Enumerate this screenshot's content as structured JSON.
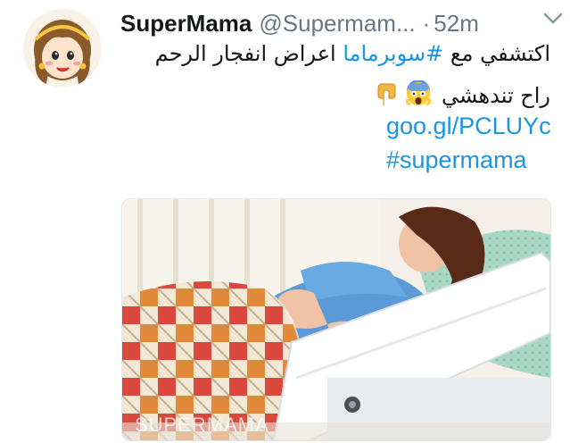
{
  "tweet": {
    "display_name": "SuperMama",
    "handle": "@Supermam...",
    "separator": "·",
    "time": "52m",
    "text_line1_prefix": "اكتشفي مع",
    "hashtag_inline": "#سوبرماما",
    "text_line1_suffix": "اعراض انفجار الرحم",
    "text_line2": "راح تندهشي",
    "link": "goo.gl/PCLUYc",
    "hashtag_en": "#supermama",
    "media_watermark": "SUPERMAMA"
  },
  "icons": {
    "caret": "chevron-down-icon",
    "emoji_1": "face-screaming-in-fear-icon",
    "emoji_2": "pointing-down-hand-icon"
  },
  "colors": {
    "link": "#1b95e0",
    "muted": "#657786",
    "text": "#14171a"
  }
}
